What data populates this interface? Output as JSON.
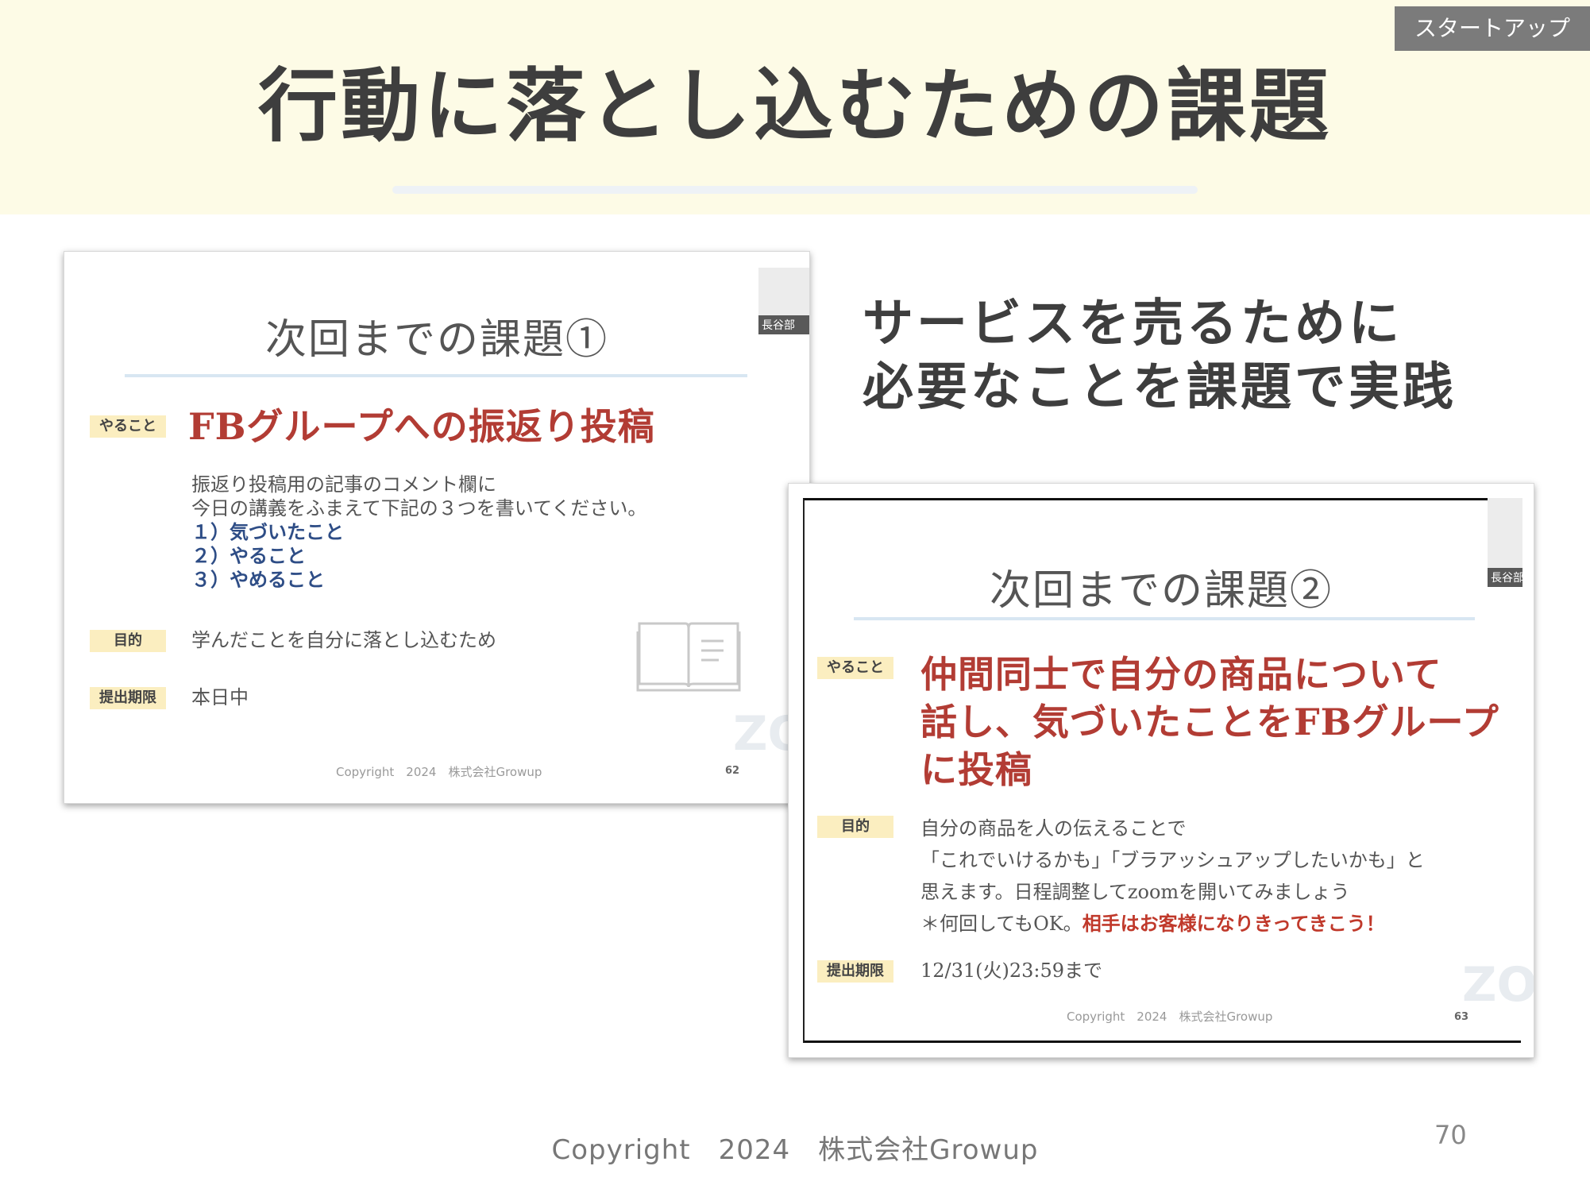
{
  "header": {
    "category": "スタートアップ",
    "title": "行動に落とし込むための課題"
  },
  "slide1": {
    "title": "次回までの課題①",
    "video_name": "長谷部",
    "todo_label": "やること",
    "todo_title": "FBグループへの振返り投稿",
    "body_lines": [
      "振返り投稿用の記事のコメント欄に",
      "今日の講義をふまえて下記の３つを書いてください。"
    ],
    "items": [
      "１）気づいたこと",
      "２）やること",
      "３）やめること"
    ],
    "purpose_label": "目的",
    "purpose_text": "学んだことを自分に落とし込むため",
    "deadline_label": "提出期限",
    "deadline_text": "本日中",
    "copyright": "Copyright　2024　株式会社Growup",
    "page": "62",
    "watermark": "ZO"
  },
  "right_heading": {
    "line1": "サービスを売るために",
    "line2": "必要なことを課題で実践"
  },
  "slide2": {
    "title": "次回までの課題②",
    "video_name": "長谷部",
    "todo_label": "やること",
    "todo_lines": [
      "仲間同士で自分の商品について",
      "話し、気づいたことをFBグループ",
      "に投稿"
    ],
    "purpose_label": "目的",
    "purpose_lines": [
      "自分の商品を人の伝えることで",
      "「これでいけるかも」「ブラアッシュアップしたいかも」と",
      "思えます。日程調整してzoomを開いてみましょう"
    ],
    "note_prefix": "＊何回してもOK。",
    "note_emphasis": "相手はお客様になりきってきこう！",
    "deadline_label": "提出期限",
    "deadline_text": "12/31(火)23:59まで",
    "copyright": "Copyright　2024　株式会社Growup",
    "page": "63",
    "watermark": "ZO"
  },
  "footer": {
    "copyright": "Copyright　2024　株式会社Growup",
    "page": "70"
  },
  "icons": {
    "book": "open-book-icon"
  }
}
